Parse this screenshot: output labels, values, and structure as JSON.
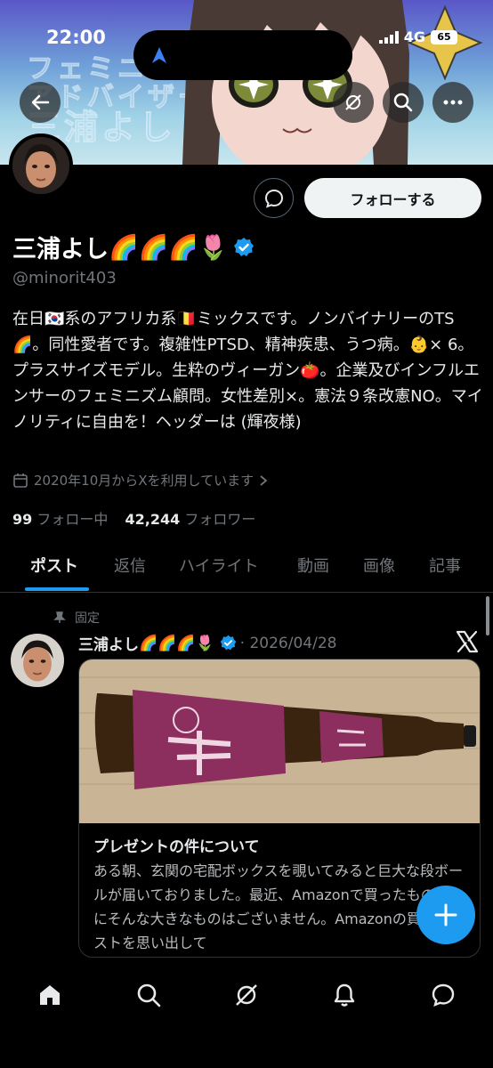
{
  "status_bar": {
    "time": "22:00",
    "network": "4G",
    "battery": "65"
  },
  "banner": {
    "line1": "フェミニスト",
    "line2": "アドバイザー",
    "line3": "三浦よし"
  },
  "profile": {
    "display_name": "三浦よし",
    "name_emoji": "🌈🌈🌈🌷",
    "handle": "@minorit403",
    "follow_label": "フォローする",
    "bio": "在日🇰🇷系のアフリカ系🇧🇪ミックスです。ノンバイナリーのTS🌈。同性愛者です。複雑性PTSD、精神疾患、うつ病。👶× 6。プラスサイズモデル。生粋のヴィーガン🍅。企業及びインフルエンサーのフェミニズム顧問。女性差別×。憲法９条改憲NO。マイノリティに自由を！ヘッダーは (輝夜様)",
    "joined": "2020年10月からXを利用しています",
    "following_count": "99",
    "following_label": "フォロー中",
    "followers_count": "42,244",
    "followers_label": "フォロワー"
  },
  "tabs": [
    "ポスト",
    "返信",
    "ハイライト",
    "動画",
    "画像",
    "記事"
  ],
  "tweet": {
    "pinned_label": "固定",
    "author": "三浦よし",
    "author_emoji": "🌈🌈🌈🌷",
    "date": "· 2026/04/28",
    "card_title": "プレゼントの件について",
    "card_desc": "ある朝、玄関の宅配ボックスを覗いてみると巨大な段ボールが届いておりました。最近、Amazonで買ったものの中にそんな大きなものはございません。Amazonの買い物リストを思い出して"
  },
  "colors": {
    "accent": "#1d9bf0",
    "background": "#000000",
    "muted": "#71767b"
  },
  "icons": [
    "back-arrow-icon",
    "grok-icon",
    "search-icon",
    "more-icon",
    "message-icon",
    "verified-badge-icon",
    "calendar-icon",
    "pin-icon",
    "x-logo-icon",
    "plus-icon",
    "home-icon",
    "explore-icon",
    "grok-nav-icon",
    "bell-icon",
    "messages-nav-icon"
  ]
}
